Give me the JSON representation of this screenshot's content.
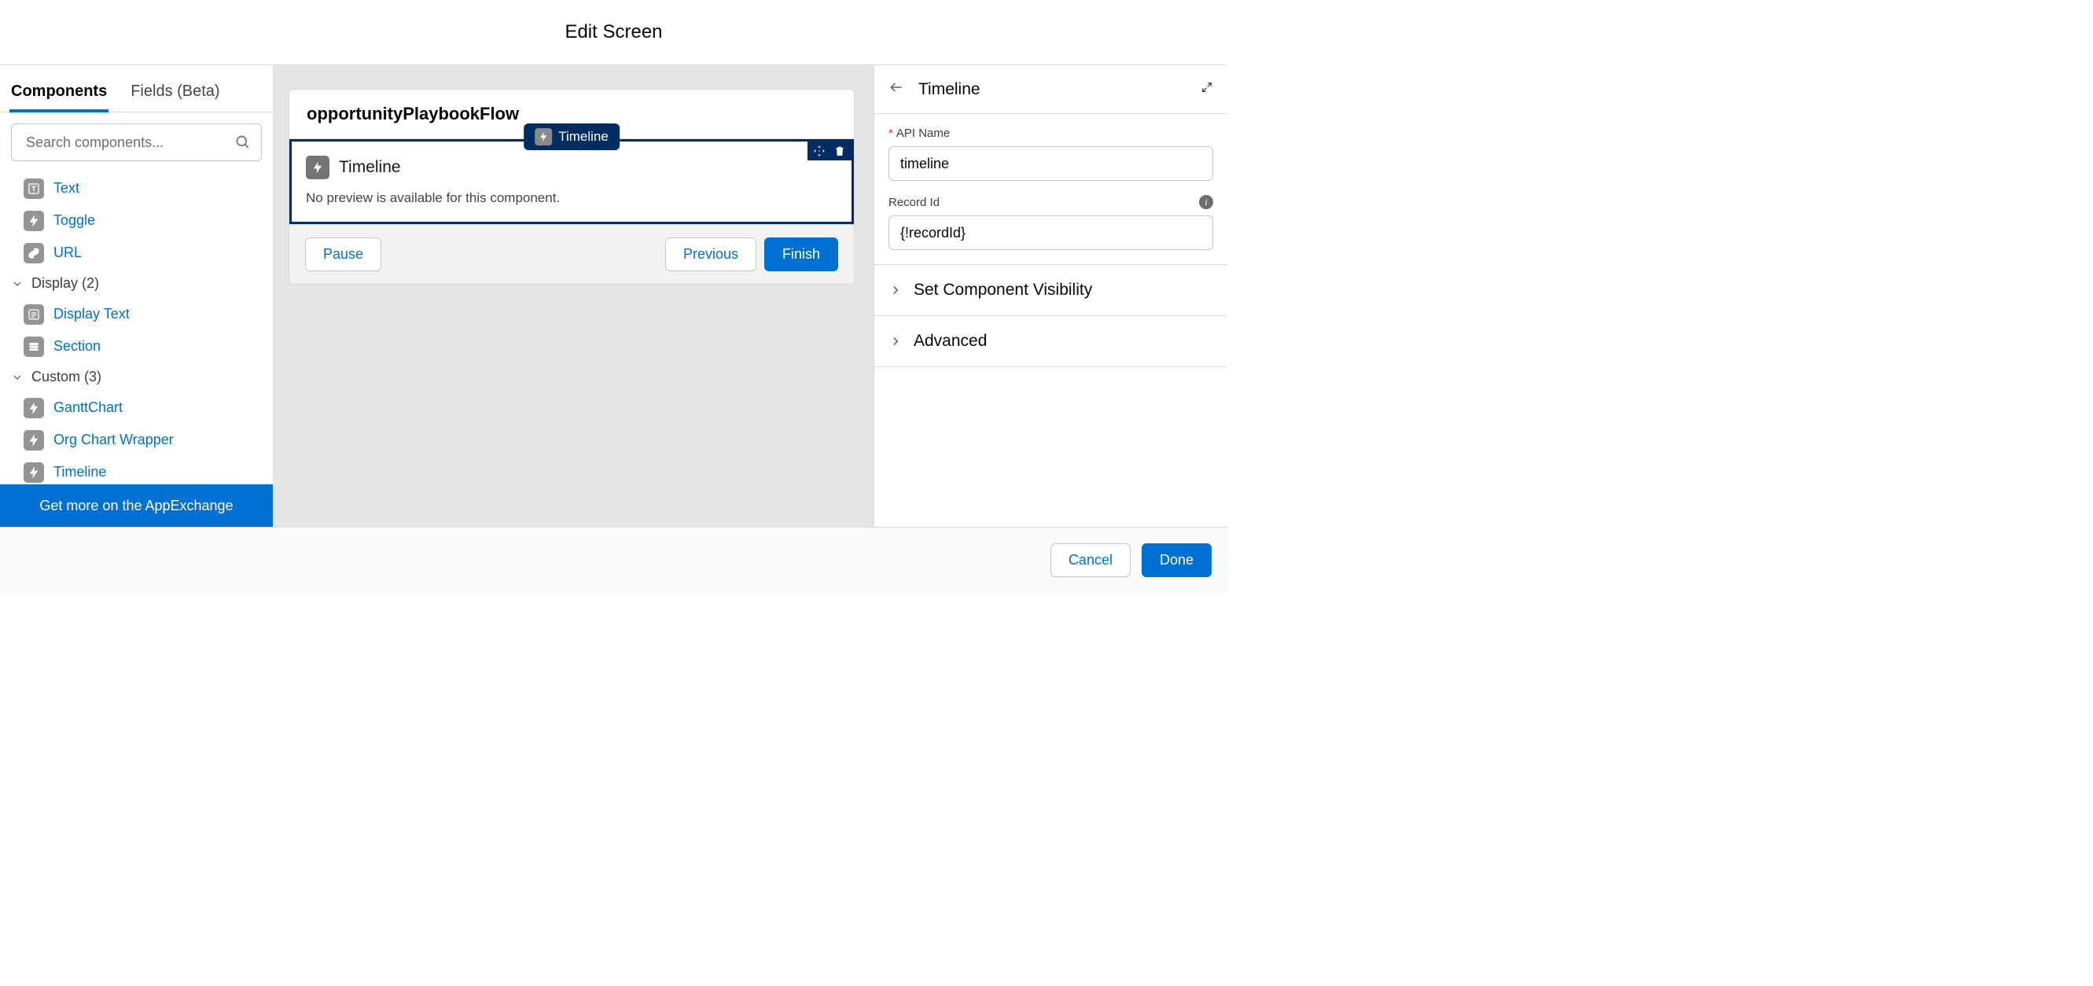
{
  "header": {
    "title": "Edit Screen"
  },
  "leftPanel": {
    "tabs": {
      "components": "Components",
      "fields": "Fields (Beta)"
    },
    "search": {
      "placeholder": "Search components..."
    },
    "straggler_items": [
      {
        "label": "Text",
        "icon": "text-chip-icon"
      },
      {
        "label": "Toggle",
        "icon": "lightning-icon"
      },
      {
        "label": "URL",
        "icon": "link-icon"
      }
    ],
    "categories": [
      {
        "label": "Display (2)",
        "items": [
          {
            "label": "Display Text",
            "icon": "display-text-icon"
          },
          {
            "label": "Section",
            "icon": "section-icon"
          }
        ]
      },
      {
        "label": "Custom (3)",
        "items": [
          {
            "label": "GanttChart",
            "icon": "lightning-icon"
          },
          {
            "label": "Org Chart Wrapper",
            "icon": "lightning-icon"
          },
          {
            "label": "Timeline",
            "icon": "lightning-icon"
          }
        ]
      }
    ],
    "appexchange": "Get more on the AppExchange"
  },
  "canvas": {
    "screen_label": "opportunityPlaybookFlow",
    "selected_chip": "Timeline",
    "component_title": "Timeline",
    "component_message": "No preview is available for this component.",
    "footer": {
      "pause": "Pause",
      "previous": "Previous",
      "finish": "Finish"
    }
  },
  "rightPanel": {
    "title": "Timeline",
    "api_name": {
      "label": "API Name",
      "value": "timeline",
      "required": true
    },
    "record_id": {
      "label": "Record Id",
      "value": "{!recordId}"
    },
    "accordion": {
      "visibility": "Set Component Visibility",
      "advanced": "Advanced"
    }
  },
  "appFooter": {
    "cancel": "Cancel",
    "done": "Done"
  }
}
